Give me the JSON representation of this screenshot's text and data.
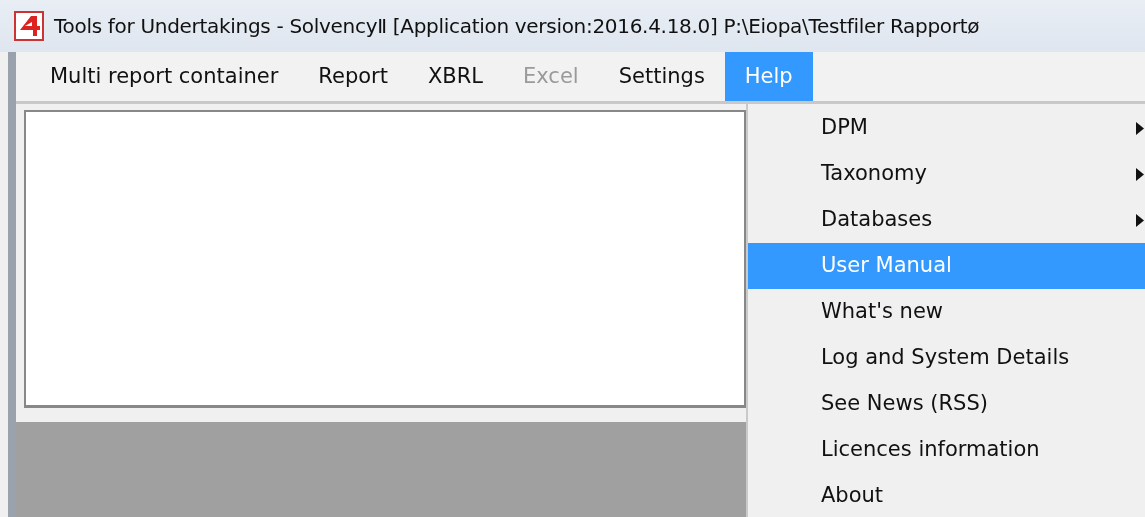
{
  "window": {
    "title": "Tools for Undertakings - SolvencyⅡ [Application version:2016.4.18.0]  P:\\Eiopa\\Testfiler Rapportø"
  },
  "menu_bar": [
    {
      "label": "Multi report container",
      "disabled": false,
      "selected": false
    },
    {
      "label": "Report",
      "disabled": false,
      "selected": false
    },
    {
      "label": "XBRL",
      "disabled": false,
      "selected": false
    },
    {
      "label": "Excel",
      "disabled": true,
      "selected": false
    },
    {
      "label": "Settings",
      "disabled": false,
      "selected": false
    },
    {
      "label": "Help",
      "disabled": false,
      "selected": true
    }
  ],
  "help_menu": [
    {
      "label": "DPM",
      "submenu": true,
      "selected": false
    },
    {
      "label": "Taxonomy",
      "submenu": true,
      "selected": false
    },
    {
      "label": "Databases",
      "submenu": true,
      "selected": false
    },
    {
      "label": "User Manual",
      "submenu": false,
      "selected": true
    },
    {
      "label": "What's new",
      "submenu": false,
      "selected": false
    },
    {
      "label": "Log and System Details",
      "submenu": false,
      "selected": false
    },
    {
      "label": "See News (RSS)",
      "submenu": false,
      "selected": false
    },
    {
      "label": "Licences information",
      "submenu": false,
      "selected": false
    },
    {
      "label": "About",
      "submenu": false,
      "selected": false
    }
  ]
}
